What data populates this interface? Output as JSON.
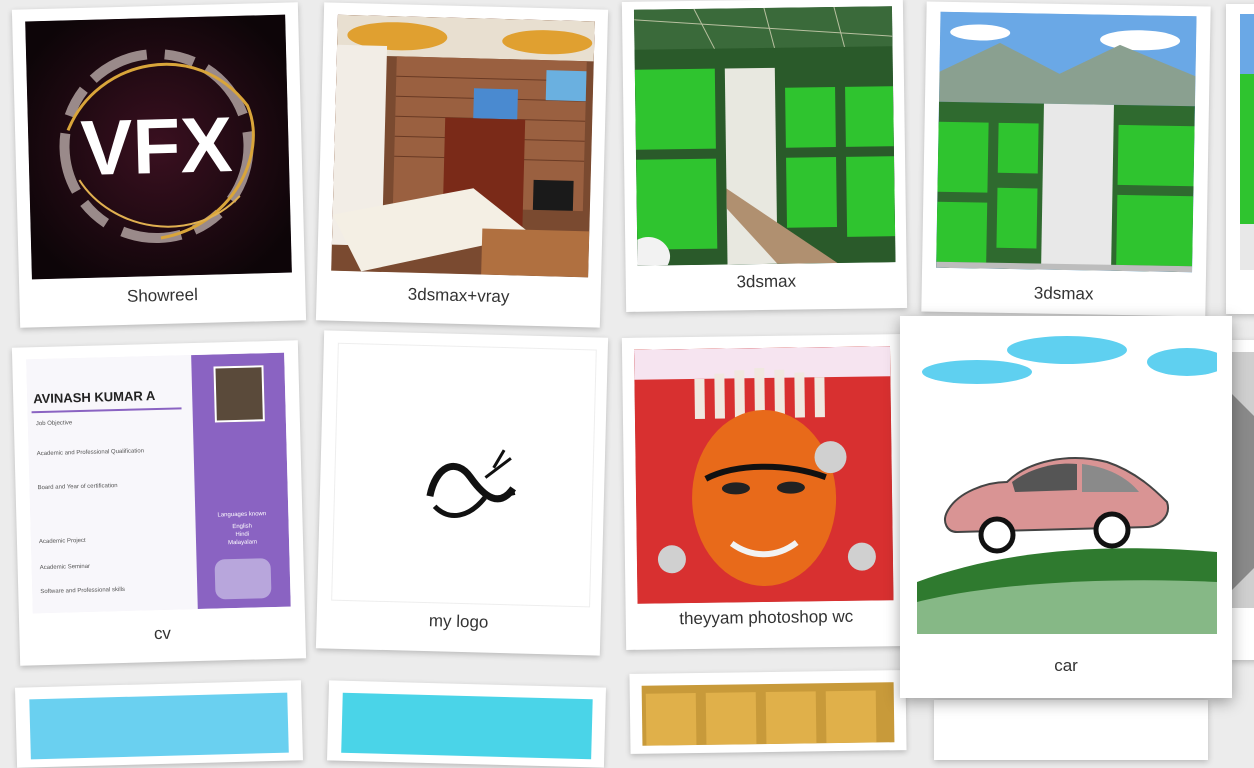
{
  "gallery": {
    "items": [
      {
        "caption": "Showreel",
        "image": "vfx-logo"
      },
      {
        "caption": "3dsmax+vray",
        "image": "bedroom-render"
      },
      {
        "caption": "3dsmax",
        "image": "building-render"
      },
      {
        "caption": "3dsmax",
        "image": "building-render-2"
      },
      {
        "caption": "cv",
        "image": "resume-document"
      },
      {
        "caption": "my logo",
        "image": "personal-logo"
      },
      {
        "caption": "theyyam photoshop wc",
        "image": "theyyam-face"
      },
      {
        "caption": "car",
        "image": "car-illustration"
      }
    ]
  },
  "cv_preview": {
    "name": "AVINASH KUMAR A",
    "sections": [
      "Job Objective",
      "Academic and Professional Qualification",
      "Board and Year of certification",
      "Academic Project",
      "Academic Seminar",
      "Software and Professional skills"
    ],
    "languages_heading": "Languages known",
    "languages": [
      "English",
      "Hindi",
      "Malayalam"
    ]
  },
  "vfx_text": "VFX",
  "colors": {
    "background": "#ececec",
    "card": "#ffffff",
    "caption": "#333333",
    "building_green": "#2fc42f",
    "cv_purple": "#8a63c2"
  }
}
